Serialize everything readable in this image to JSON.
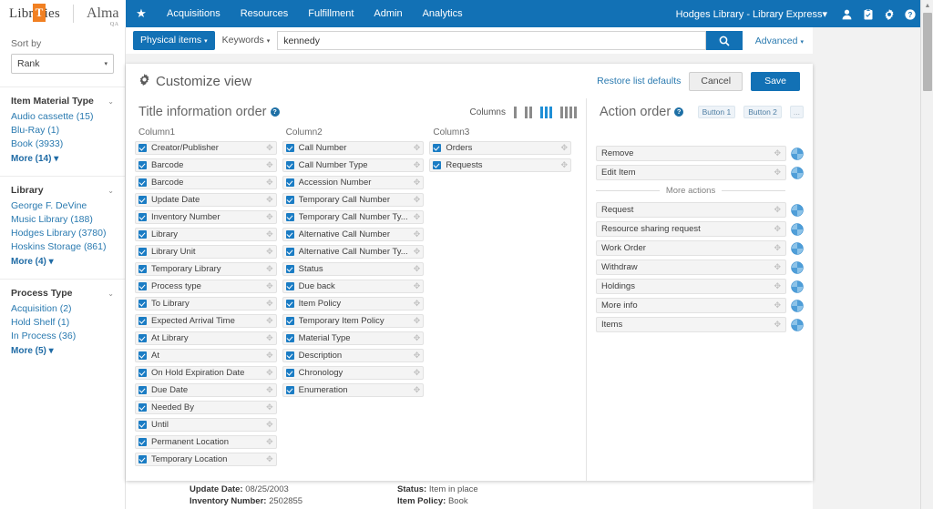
{
  "header": {
    "logo_primary": "Libraries",
    "logo_t": "T",
    "logo_secondary": "Alma",
    "logo_env": "QA",
    "star_icon": "star-icon",
    "nav": [
      {
        "label": "Acquisitions"
      },
      {
        "label": "Resources"
      },
      {
        "label": "Fulfillment"
      },
      {
        "label": "Admin"
      },
      {
        "label": "Analytics"
      }
    ],
    "user_menu": "Hodges Library - Library Express",
    "user_menu_caret": "▾",
    "icons": [
      "person-icon",
      "clipboard-icon",
      "gear-icon",
      "help-icon"
    ]
  },
  "search": {
    "scope_label": "Physical items",
    "scope_caret": "▾",
    "field_label": "Keywords",
    "field_caret": "▾",
    "query_value": "kennedy",
    "query_placeholder": "",
    "search_icon": "search-icon",
    "advanced_label": "Advanced",
    "advanced_caret": "▾"
  },
  "sidebar": {
    "sort_label": "Sort by",
    "sort_value": "Rank",
    "sort_caret": "▾",
    "facets": [
      {
        "title": "Item Material Type",
        "chevron": "⌄",
        "options": [
          "Audio cassette (15)",
          "Blu-Ray (1)",
          "Book (3933)"
        ],
        "more": "More (14) ▾"
      },
      {
        "title": "Library",
        "chevron": "⌄",
        "options": [
          "George F. DeVine Music Library (188)",
          "Hodges Library (3780)",
          "Hoskins Storage (861)"
        ],
        "more": "More (4) ▾"
      },
      {
        "title": "Process Type",
        "chevron": "⌄",
        "options": [
          "Acquisition (2)",
          "Hold Shelf (1)",
          "In Process (36)"
        ],
        "more": "More (5) ▾"
      }
    ]
  },
  "panel": {
    "title": "Customize view",
    "gear_icon": "gear-icon",
    "restore_label": "Restore list defaults",
    "cancel_label": "Cancel",
    "save_label": "Save"
  },
  "title_order": {
    "heading": "Title information order",
    "help_icon": "help-icon",
    "help_glyph": "?",
    "columns_label": "Columns",
    "layout_options": [
      {
        "bars": 1,
        "selected": false
      },
      {
        "bars": 2,
        "selected": false
      },
      {
        "bars": 3,
        "selected": true
      },
      {
        "bars": 4,
        "selected": false
      }
    ],
    "columns": [
      {
        "header": "Column1",
        "items": [
          {
            "label": "Creator/Publisher",
            "checked": true
          },
          {
            "label": "Barcode",
            "checked": true
          },
          {
            "label": "Barcode",
            "checked": true
          },
          {
            "label": "Update Date",
            "checked": true
          },
          {
            "label": "Inventory Number",
            "checked": true
          },
          {
            "label": "Library",
            "checked": true
          },
          {
            "label": "Library Unit",
            "checked": true
          },
          {
            "label": "Temporary Library",
            "checked": true
          },
          {
            "label": "Process type",
            "checked": true
          },
          {
            "label": "To Library",
            "checked": true
          },
          {
            "label": "Expected Arrival Time",
            "checked": true
          },
          {
            "label": "At Library",
            "checked": true
          },
          {
            "label": "At",
            "checked": true
          },
          {
            "label": "On Hold Expiration Date",
            "checked": true
          },
          {
            "label": "Due Date",
            "checked": true
          },
          {
            "label": "Needed By",
            "checked": true
          },
          {
            "label": "Until",
            "checked": true
          },
          {
            "label": "Permanent Location",
            "checked": true
          },
          {
            "label": "Temporary Location",
            "checked": true
          }
        ]
      },
      {
        "header": "Column2",
        "items": [
          {
            "label": "Call Number",
            "checked": true
          },
          {
            "label": "Call Number Type",
            "checked": true
          },
          {
            "label": "Accession Number",
            "checked": true
          },
          {
            "label": "Temporary Call Number",
            "checked": true
          },
          {
            "label": "Temporary Call Number Ty...",
            "checked": true
          },
          {
            "label": "Alternative Call Number",
            "checked": true
          },
          {
            "label": "Alternative Call Number Ty...",
            "checked": true
          },
          {
            "label": "Status",
            "checked": true
          },
          {
            "label": "Due back",
            "checked": true
          },
          {
            "label": "Item Policy",
            "checked": true
          },
          {
            "label": "Temporary Item Policy",
            "checked": true
          },
          {
            "label": "Material Type",
            "checked": true
          },
          {
            "label": "Description",
            "checked": true
          },
          {
            "label": "Chronology",
            "checked": true
          },
          {
            "label": "Enumeration",
            "checked": true
          }
        ]
      },
      {
        "header": "Column3",
        "items": [
          {
            "label": "Orders",
            "checked": true
          },
          {
            "label": "Requests",
            "checked": true
          }
        ]
      }
    ]
  },
  "action_order": {
    "heading": "Action order",
    "help_icon": "help-icon",
    "help_glyph": "?",
    "buttons": [
      {
        "label": "Button 1"
      },
      {
        "label": "Button 2"
      },
      {
        "label": "..."
      }
    ],
    "primary_actions": [
      {
        "label": "Remove"
      },
      {
        "label": "Edit Item"
      }
    ],
    "divider_label": "More actions",
    "more_actions": [
      {
        "label": "Request"
      },
      {
        "label": "Resource sharing request"
      },
      {
        "label": "Work Order"
      },
      {
        "label": "Withdraw"
      },
      {
        "label": "Holdings"
      },
      {
        "label": "More info"
      },
      {
        "label": "Items"
      }
    ]
  },
  "record_detail": {
    "left": [
      {
        "label": "Update Date:",
        "value": "08/25/2003"
      },
      {
        "label": "Inventory Number:",
        "value": "2502855"
      }
    ],
    "right": [
      {
        "label": "Status:",
        "value": "Item in place"
      },
      {
        "label": "Item Policy:",
        "value": "Book"
      }
    ]
  },
  "colors": {
    "brand_blue": "#1271b5",
    "accent_orange": "#f18022",
    "link_blue": "#2a7ab0"
  }
}
